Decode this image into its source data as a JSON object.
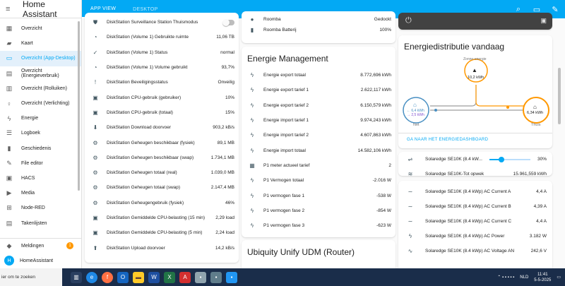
{
  "sidebar": {
    "title": "Home Assistant",
    "items": [
      {
        "label": "Overzicht",
        "icon": "dashboard-icon",
        "glyph": "▦",
        "active": false
      },
      {
        "label": "Kaart",
        "icon": "map-icon",
        "glyph": "▰",
        "active": false
      },
      {
        "label": "Overzicht (App-Desktop)",
        "icon": "monitor-icon",
        "glyph": "▭",
        "active": true
      },
      {
        "label": "Overzicht (Energieverbruik)",
        "icon": "view-dashboard-icon",
        "glyph": "▤",
        "active": false
      },
      {
        "label": "Overzicht (Rolluiken)",
        "icon": "blinds-icon",
        "glyph": "▥",
        "active": false
      },
      {
        "label": "Overzicht (Verlichting)",
        "icon": "lightbulb-icon",
        "glyph": "♀",
        "active": false
      },
      {
        "label": "Energie",
        "icon": "lightning-icon",
        "glyph": "ϟ",
        "active": false
      },
      {
        "label": "Logboek",
        "icon": "logbook-icon",
        "glyph": "☰",
        "active": false
      },
      {
        "label": "Geschiedenis",
        "icon": "chart-icon",
        "glyph": "▮",
        "active": false
      },
      {
        "label": "File editor",
        "icon": "wrench-icon",
        "glyph": "✎",
        "active": false
      },
      {
        "label": "HACS",
        "icon": "hacs-icon",
        "glyph": "▣",
        "active": false
      },
      {
        "label": "Media",
        "icon": "media-icon",
        "glyph": "▶",
        "active": false
      },
      {
        "label": "Node-RED",
        "icon": "sitemap-icon",
        "glyph": "⊞",
        "active": false
      },
      {
        "label": "Takenlijsten",
        "icon": "clipboard-list-icon",
        "glyph": "▤",
        "active": false
      }
    ],
    "notifications": {
      "label": "Meldingen",
      "count": "1"
    },
    "user": {
      "label": "HomeAssistant",
      "initial": "H"
    }
  },
  "topbar": {
    "tabs": [
      {
        "label": "APP VIEW",
        "active": true
      },
      {
        "label": "DESKTOP",
        "active": false
      }
    ],
    "icons": [
      "search-icon",
      "assist-icon",
      "pencil-icon"
    ]
  },
  "diskstation": {
    "rows": [
      {
        "name": "DiskStation Surveillance Station Thuismodus",
        "value": "",
        "icon": "shield-icon",
        "glyph": "⛊",
        "toggle": true
      },
      {
        "name": "DiskStation (Volume 1) Gebruikte ruimte",
        "value": "11,06 TB",
        "icon": "chart-pie-icon",
        "glyph": "◔"
      },
      {
        "name": "DiskStation (Volume 1) Status",
        "value": "normal",
        "icon": "check-circle-icon",
        "glyph": "✓"
      },
      {
        "name": "DiskStation (Volume 1) Volume gebruikt",
        "value": "93,7%",
        "icon": "chart-pie-icon",
        "glyph": "◔"
      },
      {
        "name": "DiskStation Beveiligingsstatus",
        "value": "Onveilig",
        "icon": "alert-circle-icon",
        "glyph": "!"
      },
      {
        "name": "DiskStation CPU-gebruik (gebruiker)",
        "value": "10%",
        "icon": "cpu-icon",
        "glyph": "▣"
      },
      {
        "name": "DiskStation CPU-gebruik (totaal)",
        "value": "15%",
        "icon": "cpu-icon",
        "glyph": "▣"
      },
      {
        "name": "DiskStation Download doorvoer",
        "value": "903,2 kB/s",
        "icon": "download-icon",
        "glyph": "⬇"
      },
      {
        "name": "DiskStation Geheugen beschikbaar (fysiek)",
        "value": "89,1 MB",
        "icon": "memory-icon",
        "glyph": "⚙"
      },
      {
        "name": "DiskStation Geheugen beschikbaar (swap)",
        "value": "1.734,1 MB",
        "icon": "memory-icon",
        "glyph": "⚙"
      },
      {
        "name": "DiskStation Geheugen totaal (real)",
        "value": "1.039,0 MB",
        "icon": "memory-icon",
        "glyph": "⚙"
      },
      {
        "name": "DiskStation Geheugen totaal (swap)",
        "value": "2.147,4 MB",
        "icon": "memory-icon",
        "glyph": "⚙"
      },
      {
        "name": "DiskStation Geheugengebruik (fysiek)",
        "value": "46%",
        "icon": "memory-icon",
        "glyph": "⚙"
      },
      {
        "name": "DiskStation Gemiddelde CPU-belasting (15 min)",
        "value": "2,29 load",
        "icon": "cpu-icon",
        "glyph": "▣"
      },
      {
        "name": "DiskStation Gemiddelde CPU-belasting (5 min)",
        "value": "2,24 load",
        "icon": "cpu-icon",
        "glyph": "▣"
      },
      {
        "name": "DiskStation Upload doorvoer",
        "value": "14,2 kB/s",
        "icon": "upload-icon",
        "glyph": "⬆"
      }
    ]
  },
  "roomba": {
    "rows": [
      {
        "name": "Roomba",
        "value": "Gedockt",
        "icon": "robot-vacuum-icon",
        "glyph": "●"
      },
      {
        "name": "Roomba Batterij",
        "value": "100%",
        "icon": "battery-icon",
        "glyph": "▮"
      }
    ]
  },
  "energie": {
    "title": "Energie Management",
    "rows": [
      {
        "name": "Energie export totaal",
        "value": "8.772,696 kWh",
        "icon": "lightning-icon",
        "glyph": "ϟ"
      },
      {
        "name": "Energie export tarief 1",
        "value": "2.622,117 kWh",
        "icon": "lightning-icon",
        "glyph": "ϟ"
      },
      {
        "name": "Energie export tarief 2",
        "value": "6.150,579 kWh",
        "icon": "lightning-icon",
        "glyph": "ϟ"
      },
      {
        "name": "Energie import tarief 1",
        "value": "9.974,243 kWh",
        "icon": "lightning-icon",
        "glyph": "ϟ"
      },
      {
        "name": "Energie import tarief 2",
        "value": "4.607,863 kWh",
        "icon": "lightning-icon",
        "glyph": "ϟ"
      },
      {
        "name": "Energie import totaal",
        "value": "14.582,106 kWh",
        "icon": "lightning-icon",
        "glyph": "ϟ"
      },
      {
        "name": "P1 meter actueel tarief",
        "value": "2",
        "icon": "calendar-clock-icon",
        "glyph": "▦"
      },
      {
        "name": "P1 Vermogen totaal",
        "value": "-2.016 W",
        "icon": "flash-icon",
        "glyph": "ϟ"
      },
      {
        "name": "P1 vermogen fase 1",
        "value": "-538 W",
        "icon": "flash-icon",
        "glyph": "ϟ"
      },
      {
        "name": "P1 vermogen fase 2",
        "value": "-854 W",
        "icon": "flash-icon",
        "glyph": "ϟ"
      },
      {
        "name": "P1 vermogen fase 3",
        "value": "-623 W",
        "icon": "flash-icon",
        "glyph": "ϟ"
      }
    ]
  },
  "ubiquity": {
    "title": "Ubiquity Unify UDM (Router)"
  },
  "distribution": {
    "title": "Energiedistributie vandaag",
    "solar_label": "Zonne-energie",
    "solar_value": "10,2 kWh",
    "grid_in": "← 6,4 kWh",
    "grid_out": "→ 2,5 kWh",
    "grid_label": "Net",
    "home_value": "6,34 kWh",
    "home_label": "Thuis",
    "link": "GA NAAR HET ENERGIEDASHBOARD",
    "colors": {
      "solar": "#ff9800",
      "grid_in": "#488fc2",
      "grid_out": "#8353d1",
      "home": "#ff9800",
      "link": "#03a9f4"
    }
  },
  "solar": {
    "slider": {
      "name": "Solaredge SE10K (8.4 kW...",
      "value": "30%",
      "fraction": 0.3
    },
    "rows_top": [
      {
        "name": "Solaredge SE10K-Tot opwek",
        "value": "15.961,559 kWh",
        "icon": "solar-power-icon",
        "glyph": "≋"
      }
    ],
    "rows": [
      {
        "name": "Solaredge SE10K (8.4 kWp) AC Current A",
        "value": "4,4 A",
        "icon": "current-ac-icon",
        "glyph": "∼"
      },
      {
        "name": "Solaredge SE10K (8.4 kWp) AC Current B",
        "value": "4,39 A",
        "icon": "current-ac-icon",
        "glyph": "∼"
      },
      {
        "name": "Solaredge SE10K (8.4 kWp) AC Current C",
        "value": "4,4 A",
        "icon": "current-ac-icon",
        "glyph": "∼"
      },
      {
        "name": "Solaredge SE10K (8.4 kWp) AC Power",
        "value": "3.182 W",
        "icon": "flash-icon",
        "glyph": "ϟ"
      },
      {
        "name": "Solaredge SE10K (8.4 kWp) AC Voltage AN",
        "value": "242,6 V",
        "icon": "sine-wave-icon",
        "glyph": "∿"
      }
    ]
  },
  "taskbar": {
    "search_text": "ier om te zoeken",
    "lang": "NLD",
    "time": "11:41",
    "date": "5-5-2025"
  }
}
